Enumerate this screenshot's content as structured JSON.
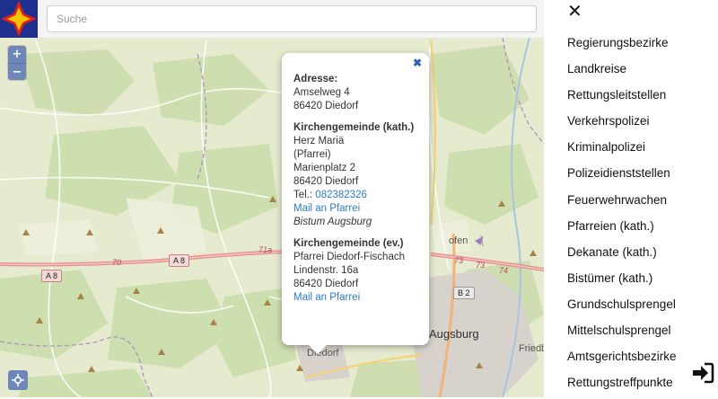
{
  "search": {
    "placeholder": "Suche"
  },
  "map": {
    "zoom_in": "+",
    "zoom_out": "−",
    "labels": {
      "diedorf": "Diedorf",
      "augsburg": "Augsburg",
      "friedberg": "Friedb",
      "hofen": "ofen"
    },
    "shields": {
      "a8_left": "A 8",
      "a8_mid": "A 8",
      "b2": "B 2"
    },
    "road_numbers": {
      "r70": "70",
      "r71a": "71a",
      "r73a": "73",
      "r73b": "73",
      "r74": "74"
    }
  },
  "popup": {
    "close": "✖",
    "address": {
      "heading": "Adresse:",
      "street": "Amselweg 4",
      "city": "86420 Diedorf"
    },
    "kath": {
      "heading": "Kirchengemeinde (kath.)",
      "name": "Herz Mariä",
      "type": "(Pfarrei)",
      "street": "Marienplatz 2",
      "city": "86420 Diedorf",
      "tel_label": "Tel.: ",
      "tel": "082382326",
      "mail": "Mail an Pfarrei",
      "diocese": "Bistum Augsburg"
    },
    "ev": {
      "heading": "Kirchengemeinde (ev.)",
      "name": "Pfarrei Diedorf-Fischach",
      "street": "Lindenstr. 16a",
      "city": "86420 Diedorf",
      "mail": "Mail an Pfarrei"
    }
  },
  "sidebar": {
    "close": "✕",
    "items": [
      "Regierungsbezirke",
      "Landkreise",
      "Rettungsleitstellen",
      "Verkehrspolizei",
      "Kriminalpolizei",
      "Polizeidienststellen",
      "Feuerwehrwachen",
      "Pfarreien (kath.)",
      "Dekanate (kath.)",
      "Bistümer (kath.)",
      "Grundschulsprengel",
      "Mittelschulsprengel",
      "Amtsgerichtsbezirke",
      "Rettungstreffpunkte"
    ]
  },
  "colors": {
    "logo_bg": "#1f2f8c",
    "logo_star_red": "#e0201c",
    "logo_star_yellow": "#f5c400",
    "control_blue": "#6f86b8",
    "link_blue": "#2b7bc9",
    "motorway": "#e88a8a"
  },
  "icons": {
    "logo": "compass-star-icon",
    "locate": "crosshair-icon",
    "logout": "sign-in-arrow-icon"
  }
}
